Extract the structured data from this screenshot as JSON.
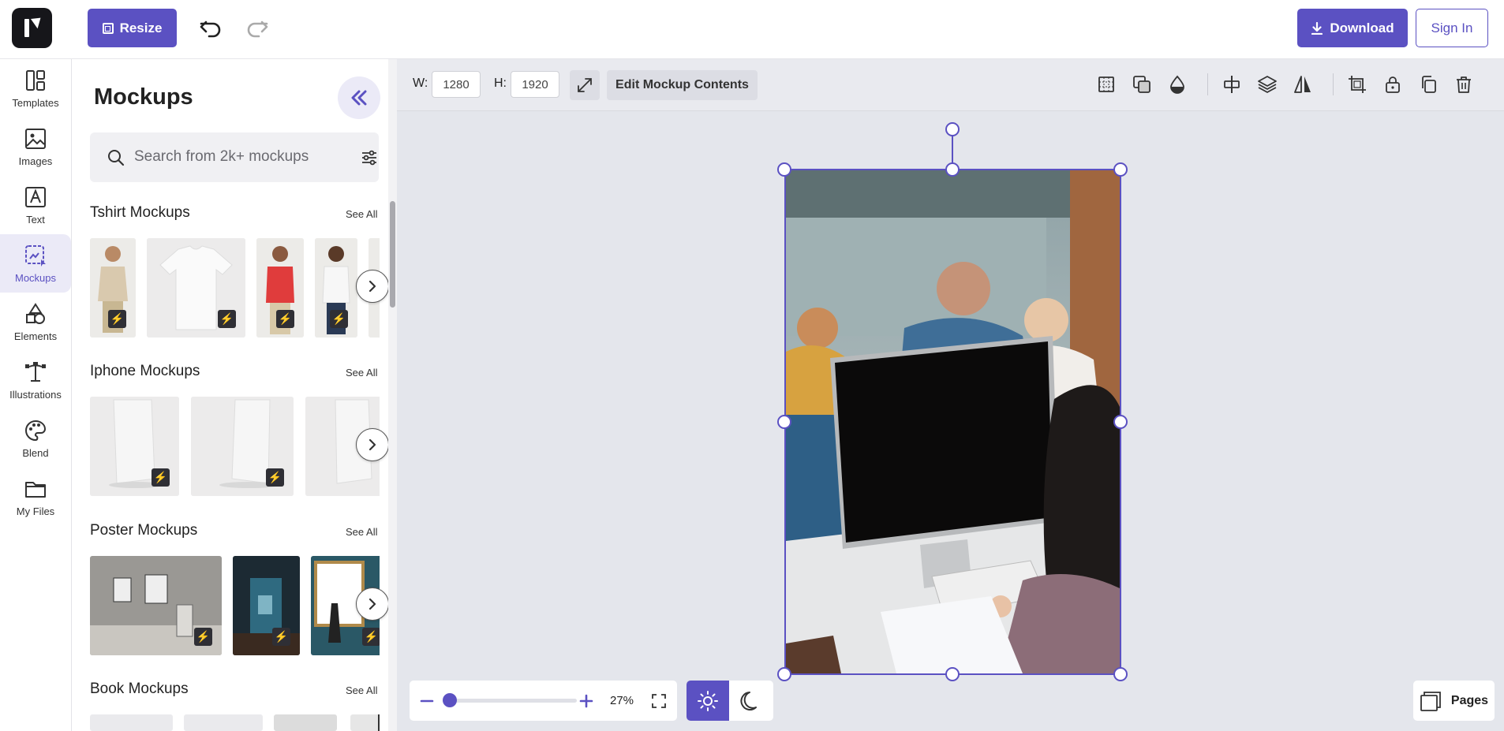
{
  "topbar": {
    "resize_label": "Resize",
    "download_label": "Download",
    "signin_label": "Sign In"
  },
  "rail": {
    "items": [
      {
        "label": "Templates",
        "icon": "templates-icon"
      },
      {
        "label": "Images",
        "icon": "image-icon"
      },
      {
        "label": "Text",
        "icon": "text-icon"
      },
      {
        "label": "Mockups",
        "icon": "mockup-icon"
      },
      {
        "label": "Elements",
        "icon": "elements-icon"
      },
      {
        "label": "Illustrations",
        "icon": "illustrations-icon"
      },
      {
        "label": "Blend",
        "icon": "palette-icon"
      },
      {
        "label": "My Files",
        "icon": "folder-icon"
      }
    ],
    "active": "Mockups"
  },
  "panel": {
    "title": "Mockups",
    "search_placeholder": "Search from 2k+ mockups",
    "sections": [
      {
        "title": "Tshirt Mockups",
        "see_all": "See All"
      },
      {
        "title": "Iphone Mockups",
        "see_all": "See All"
      },
      {
        "title": "Poster Mockups",
        "see_all": "See All"
      },
      {
        "title": "Book Mockups",
        "see_all": "See All"
      }
    ]
  },
  "toolbar": {
    "width_label": "W:",
    "width_value": "1280",
    "height_label": "H:",
    "height_value": "1920",
    "edit_label": "Edit Mockup Contents",
    "tools": [
      "grid-icon",
      "overlay-icon",
      "opacity-icon",
      "align-icon",
      "layers-icon",
      "flip-icon",
      "crop-icon",
      "lock-icon",
      "duplicate-icon",
      "trash-icon"
    ]
  },
  "zoom": {
    "value_label": "27%",
    "value": 27
  },
  "pages": {
    "label": "Pages"
  },
  "colors": {
    "accent": "#5b51c2",
    "canvas_bg": "#e4e6ec"
  }
}
